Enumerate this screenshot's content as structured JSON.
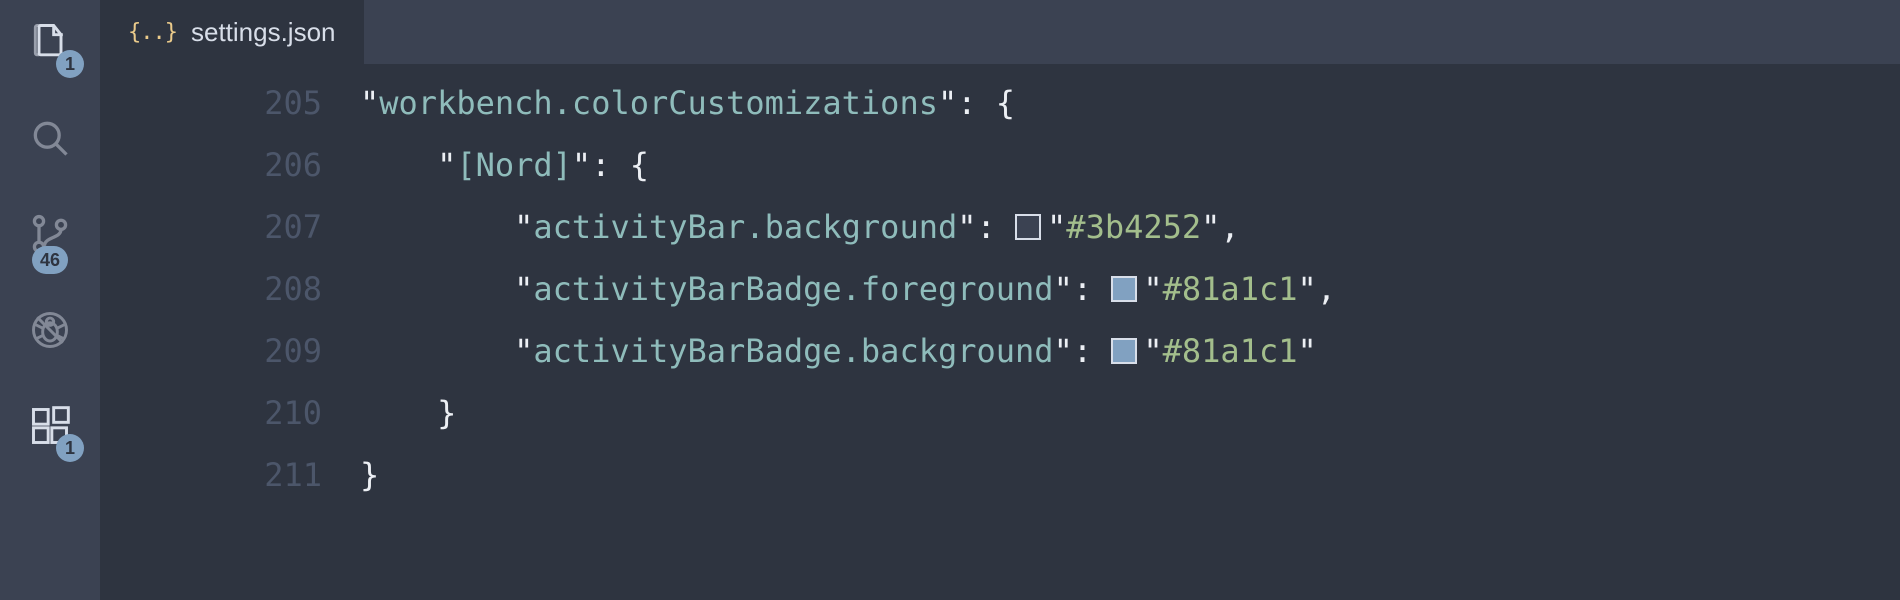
{
  "activityBar": {
    "explorerBadge": "1",
    "scmBadge": "46",
    "extensionsBadge": "1"
  },
  "tabs": {
    "active": {
      "label": "settings.json",
      "iconText": "{..}"
    }
  },
  "editor": {
    "gutter": [
      "205",
      "206",
      "207",
      "208",
      "209",
      "210",
      "211"
    ],
    "lines": [
      {
        "indent": "",
        "key": "workbench.colorCustomizations",
        "openBrace": true
      },
      {
        "indent": "    ",
        "key": "[Nord]",
        "openBrace": true
      },
      {
        "indent": "        ",
        "key": "activityBar.background",
        "value": "#3b4252",
        "swatch": "#3b4252",
        "comma": true
      },
      {
        "indent": "        ",
        "key": "activityBarBadge.foreground",
        "value": "#81a1c1",
        "swatch": "#81a1c1",
        "comma": true
      },
      {
        "indent": "        ",
        "key": "activityBarBadge.background",
        "value": "#81a1c1",
        "swatch": "#81a1c1",
        "comma": false
      },
      {
        "indent": "    ",
        "closeBrace": true
      },
      {
        "indent": "",
        "closeBrace": true
      }
    ]
  }
}
